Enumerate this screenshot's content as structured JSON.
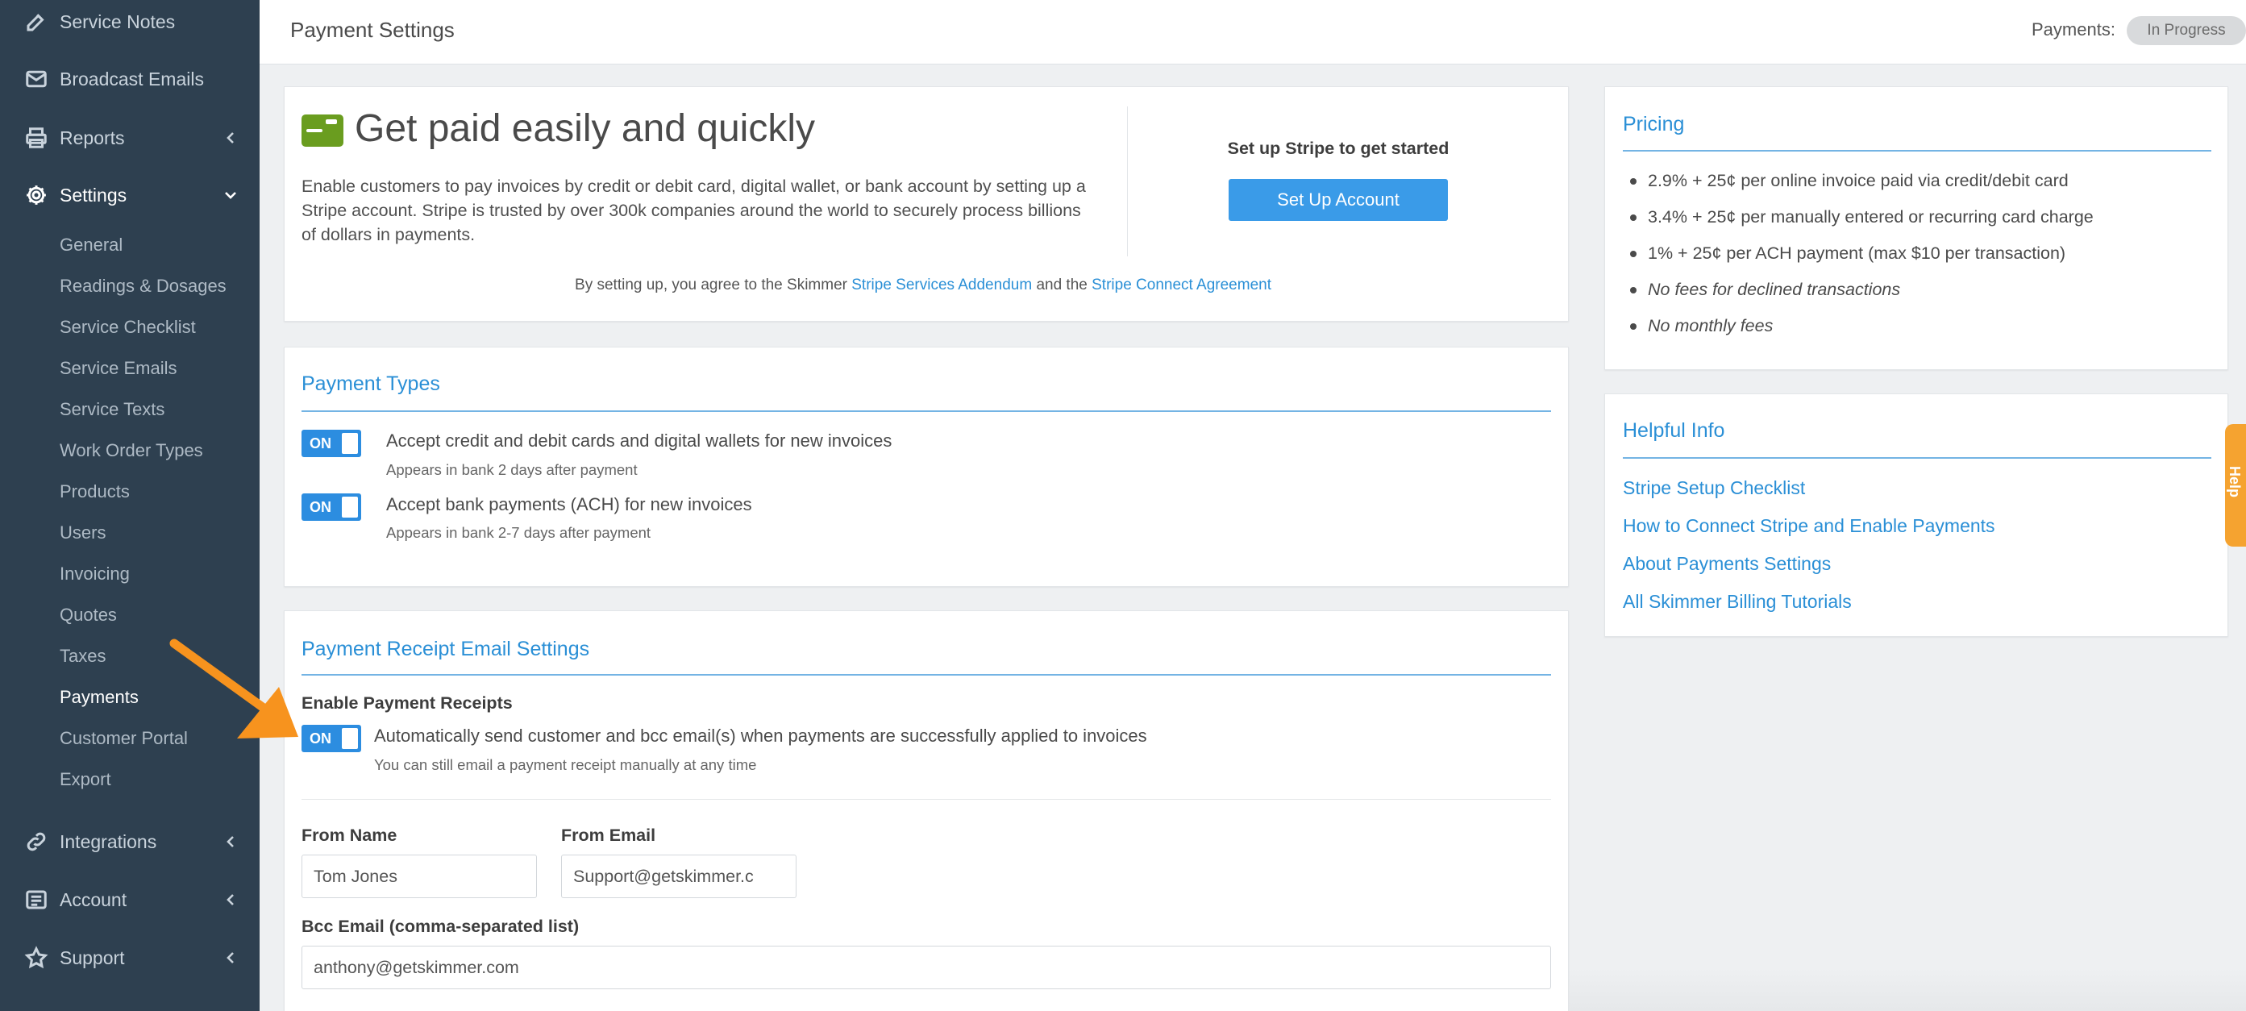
{
  "sidebar": {
    "items": [
      {
        "label": "Service Notes",
        "icon": "edit-icon"
      },
      {
        "label": "Broadcast Emails",
        "icon": "envelope-icon"
      },
      {
        "label": "Reports",
        "icon": "printer-icon"
      },
      {
        "label": "Settings",
        "icon": "gear-icon"
      },
      {
        "label": "Integrations",
        "icon": "link-icon"
      },
      {
        "label": "Account",
        "icon": "list-icon"
      },
      {
        "label": "Support",
        "icon": "star-icon"
      }
    ],
    "settings_sub": [
      "General",
      "Readings & Dosages",
      "Service Checklist",
      "Service Emails",
      "Service Texts",
      "Work Order Types",
      "Products",
      "Users",
      "Invoicing",
      "Quotes",
      "Taxes",
      "Payments",
      "Customer Portal",
      "Export"
    ]
  },
  "header": {
    "title": "Payment Settings",
    "payments_label": "Payments:",
    "payments_status": "In Progress"
  },
  "hero": {
    "title": "Get paid easily and quickly",
    "description": "Enable customers to pay invoices by credit or debit card, digital wallet, or bank account by setting up a Stripe account. Stripe is trusted by over 300k companies around the world to securely process billions of dollars in payments.",
    "setup_heading": "Set up Stripe to get started",
    "setup_button": "Set Up Account",
    "agree_prefix": "By setting up, you agree to the Skimmer",
    "agree_link1": "Stripe Services Addendum",
    "agree_mid": "and the",
    "agree_link2": "Stripe Connect Agreement"
  },
  "payment_types": {
    "title": "Payment Types",
    "options": [
      {
        "toggle": "ON",
        "label": "Accept credit and debit cards and digital wallets for new invoices",
        "sub": "Appears in bank 2 days after payment"
      },
      {
        "toggle": "ON",
        "label": "Accept bank payments (ACH) for new invoices",
        "sub": "Appears in bank 2-7 days after payment"
      }
    ]
  },
  "receipt": {
    "title": "Payment Receipt Email Settings",
    "enable_label": "Enable Payment Receipts",
    "toggle": "ON",
    "auto_label": "Automatically send customer and bcc email(s) when payments are successfully applied to invoices",
    "auto_sub": "You can still email a payment receipt manually at any time",
    "from_name_label": "From Name",
    "from_name_value": "Tom Jones",
    "from_email_label": "From Email",
    "from_email_value": "Support@getskimmer.c",
    "bcc_label": "Bcc Email (comma-separated list)",
    "bcc_value": "anthony@getskimmer.com"
  },
  "pricing": {
    "title": "Pricing",
    "items": [
      "2.9% + 25¢ per online invoice paid via credit/debit card",
      "3.4% + 25¢ per manually entered or recurring card charge",
      "1% + 25¢ per ACH payment (max $10 per transaction)",
      "No fees for declined transactions",
      "No monthly fees"
    ]
  },
  "helpful": {
    "title": "Helpful Info",
    "links": [
      "Stripe Setup Checklist",
      "How to Connect Stripe and Enable Payments",
      "About Payments Settings",
      "All Skimmer Billing Tutorials"
    ]
  },
  "help_tab": "Help",
  "colors": {
    "sidebar_bg": "#2e4050",
    "accent_blue": "#2a8fd6",
    "toggle_blue": "#2c8de0",
    "button_blue": "#3a9be8",
    "arrow_orange": "#f7931e",
    "stripe_green": "#6a9d1f"
  }
}
